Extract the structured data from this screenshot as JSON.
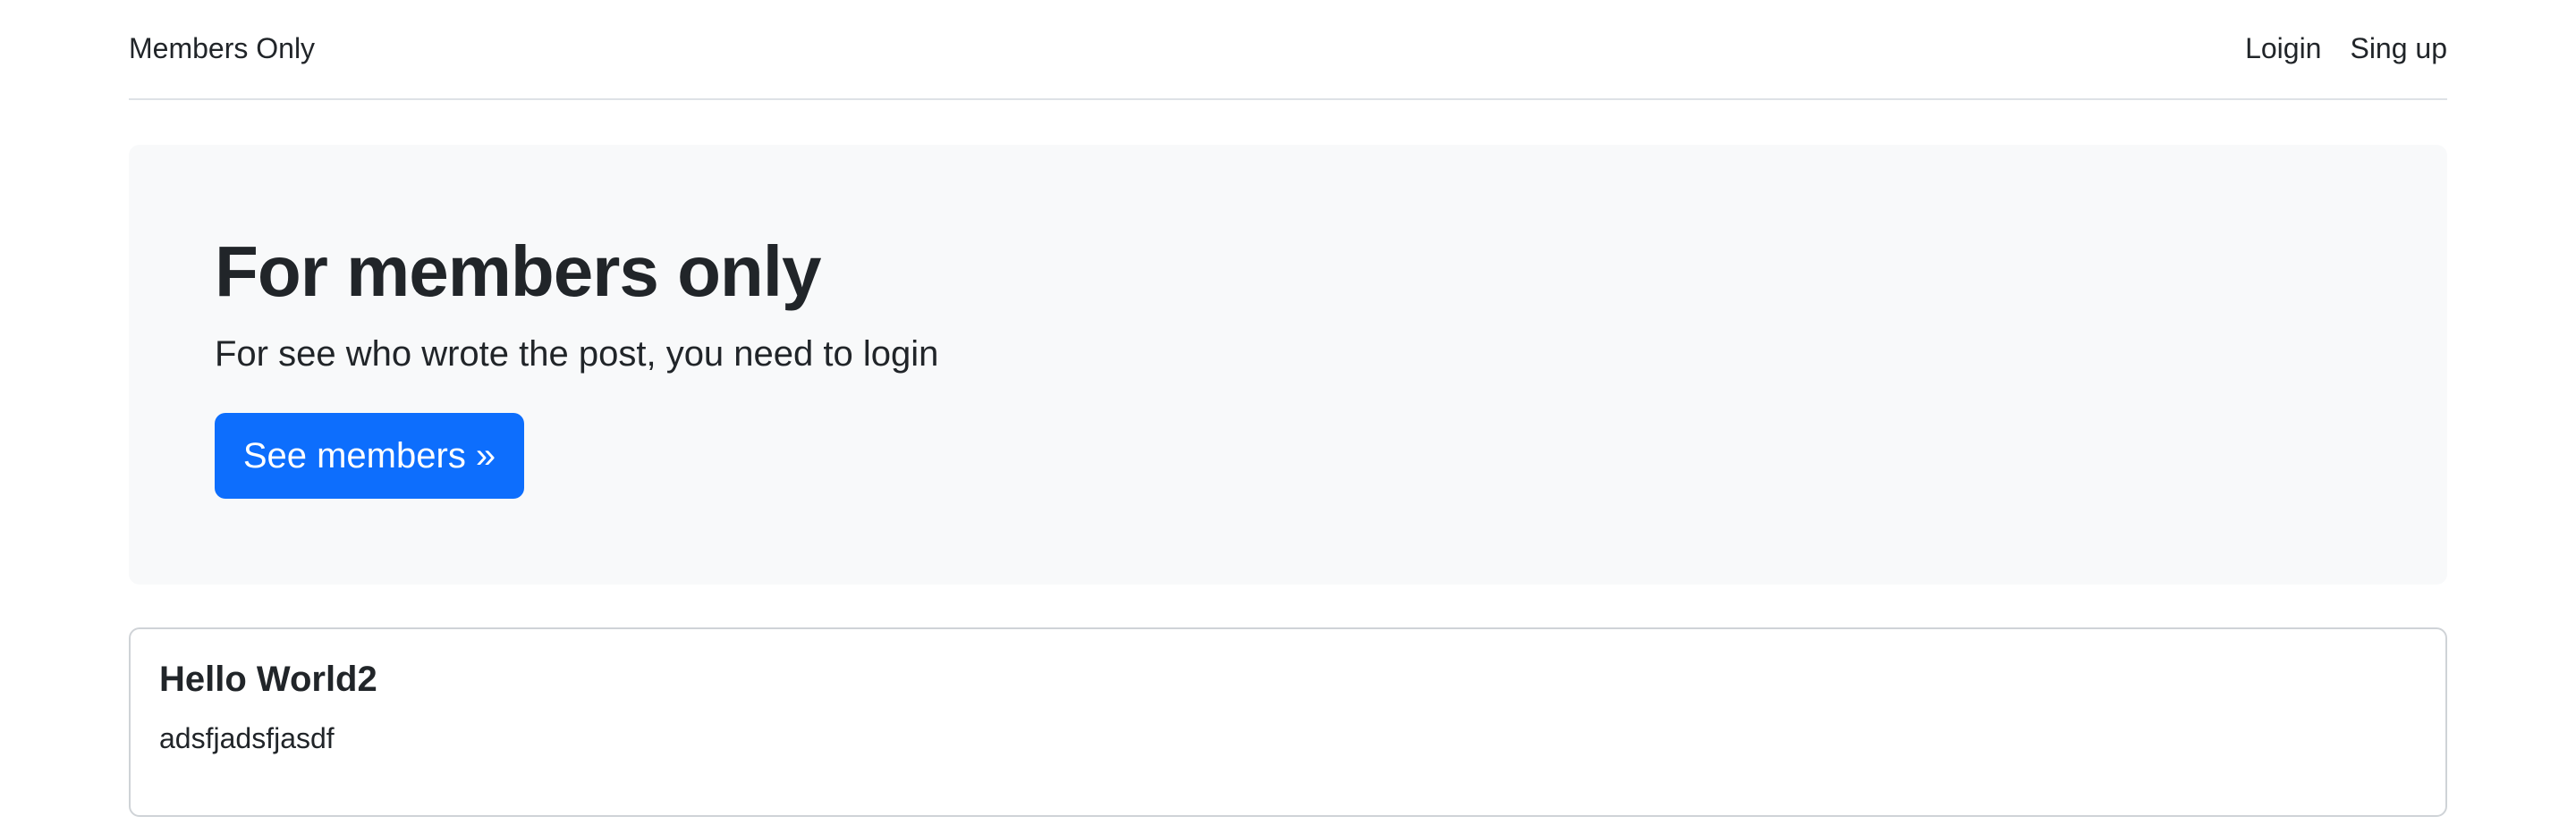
{
  "header": {
    "brand": "Members Only",
    "nav": [
      {
        "label": "Loigin"
      },
      {
        "label": "Sing up"
      }
    ]
  },
  "hero": {
    "title": "For members only",
    "subtitle": "For see who wrote the post, you need to login",
    "button_label": "See members »"
  },
  "posts": [
    {
      "title": "Hello World2",
      "body": "adsfjadsfjasdf"
    }
  ],
  "colors": {
    "accent": "#0d6efd",
    "hero_bg": "#f8f9fa",
    "text": "#212529"
  }
}
